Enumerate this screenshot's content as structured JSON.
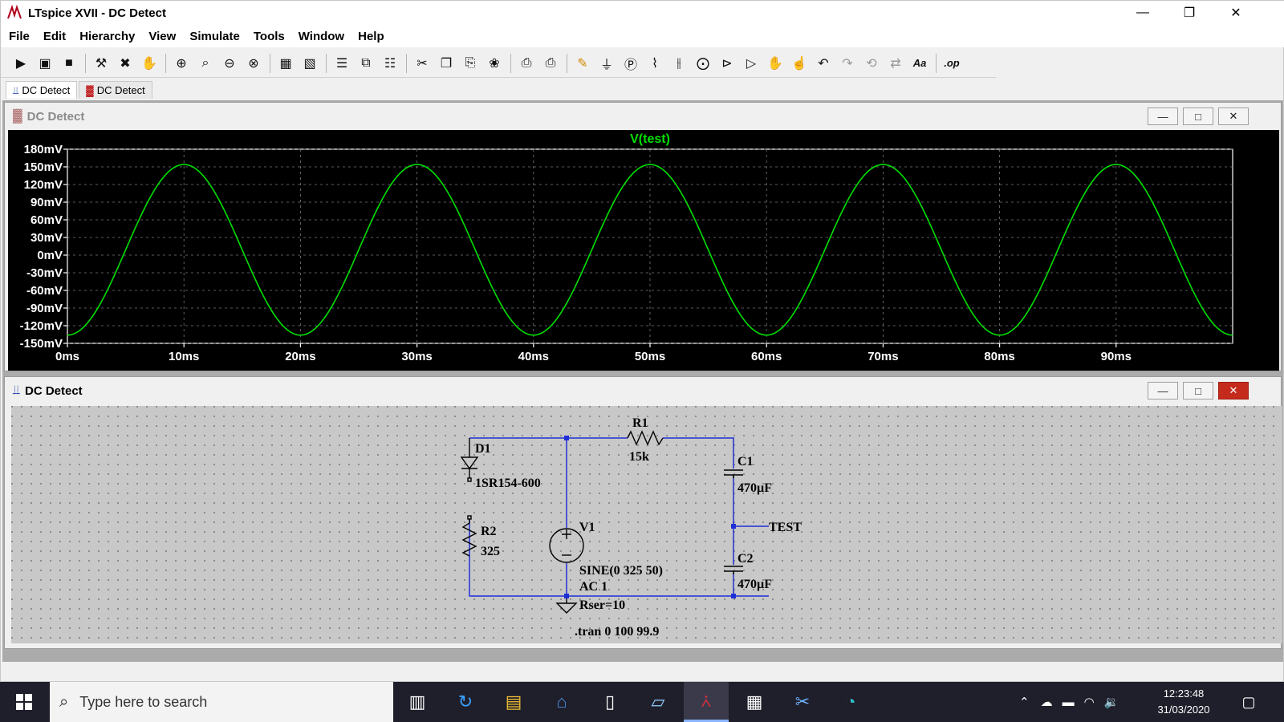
{
  "window": {
    "title": "LTspice XVII - DC Detect"
  },
  "menu": [
    "File",
    "Edit",
    "Hierarchy",
    "View",
    "Simulate",
    "Tools",
    "Window",
    "Help"
  ],
  "toolbar": [
    "run-icon",
    "open-icon",
    "save-icon",
    "control-panel-icon",
    "halt-icon",
    "pan-hand-icon",
    "zoom-in-icon",
    "zoom-fit-icon",
    "zoom-out-icon",
    "zoom-cancel-icon",
    "autorange-icon",
    "delete-plot-icon",
    "tile-horizontal-icon",
    "cascade-icon",
    "tile-vertical-icon",
    "cut-icon",
    "copy-icon",
    "paste-icon",
    "find-icon",
    "print-setup-icon",
    "print-icon",
    "draw-wire-icon",
    "ground-icon",
    "label-net-icon",
    "resistor-icon",
    "capacitor-icon",
    "inductor-icon",
    "diode-icon",
    "component-icon",
    "move-icon",
    "drag-icon",
    "undo-icon",
    "redo-icon",
    "rotate-icon",
    "mirror-icon",
    "text-icon",
    "spice-directive-icon"
  ],
  "tabs": [
    {
      "label": "DC Detect",
      "active": true,
      "icon": "schematic-icon"
    },
    {
      "label": "DC Detect",
      "active": false,
      "icon": "waveform-icon"
    }
  ],
  "plot_window": {
    "title": "DC Detect"
  },
  "schematic_window": {
    "title": "DC Detect"
  },
  "chart_data": {
    "type": "line",
    "title": "V(test)",
    "x_unit": "ms",
    "xlim": [
      0,
      100
    ],
    "ylim": [
      -150,
      180
    ],
    "x_ticks": [
      "0ms",
      "10ms",
      "20ms",
      "30ms",
      "40ms",
      "50ms",
      "60ms",
      "70ms",
      "80ms",
      "90ms"
    ],
    "y_ticks": [
      "180mV",
      "150mV",
      "120mV",
      "90mV",
      "60mV",
      "30mV",
      "0mV",
      "-30mV",
      "-60mV",
      "-90mV",
      "-120mV",
      "-150mV"
    ],
    "grid": true,
    "series": [
      {
        "name": "V(test)",
        "color": "#00e000",
        "waveform": "sine",
        "frequency_hz": 50,
        "amplitude_mV": 145,
        "offset_mV": 9,
        "peaks_ms": [
          10,
          30,
          50,
          70,
          90
        ],
        "troughs_ms": [
          0,
          20,
          40,
          60,
          80,
          100
        ]
      }
    ]
  },
  "schematic": {
    "labels": {
      "d1_name": "D1",
      "d1_value": "1SR154-600",
      "r1_name": "R1",
      "r1_value": "15k",
      "r2_name": "R2",
      "r2_value": "325",
      "c1_name": "C1",
      "c1_value": "470µF",
      "c2_name": "C2",
      "c2_value": "470µF",
      "v1_name": "V1",
      "v1_line1": "SINE(0 325 50)",
      "v1_line2": "AC 1",
      "v1_line3": "Rser=10",
      "net_label": "TEST",
      "directive": ".tran 0 100 99.9"
    },
    "wire_color": "#1f2fd6"
  },
  "taskbar": {
    "search_placeholder": "Type here to search",
    "time": "12:23:48",
    "date": "31/03/2020"
  }
}
